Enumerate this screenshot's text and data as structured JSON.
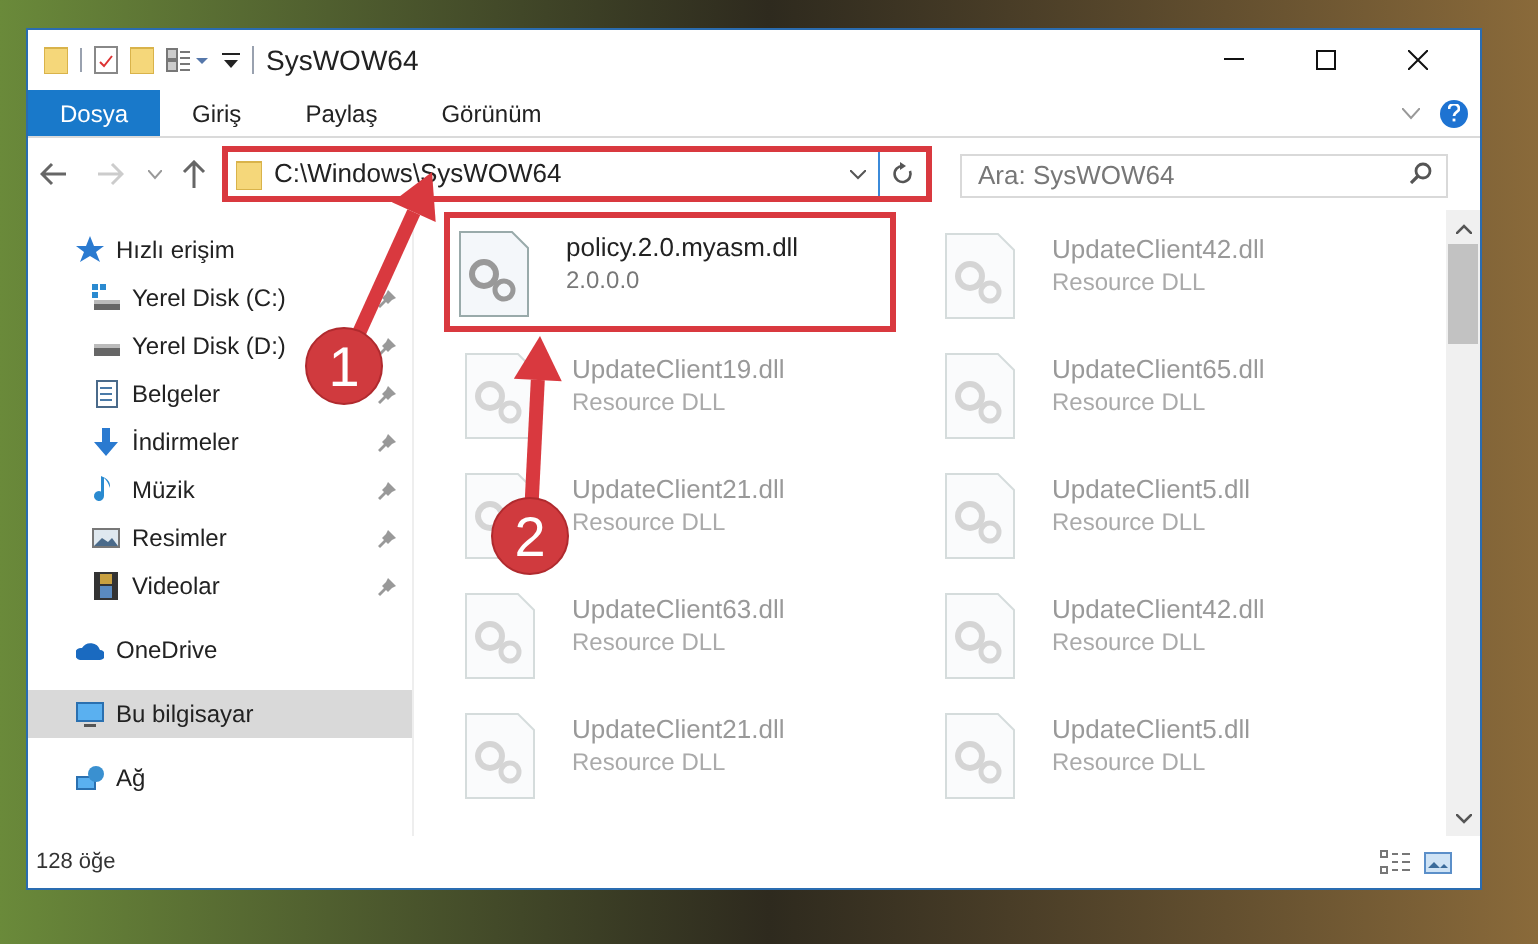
{
  "window": {
    "title": "SysWOW64"
  },
  "ribbon_tabs": [
    {
      "label": "Dosya",
      "selected": true
    },
    {
      "label": "Giriş",
      "selected": false
    },
    {
      "label": "Paylaş",
      "selected": false
    },
    {
      "label": "Görünüm",
      "selected": false
    }
  ],
  "address_bar": {
    "path": "C:\\Windows\\SysWOW64",
    "highlighted": true
  },
  "search": {
    "placeholder": "Ara: SysWOW64"
  },
  "sidebar": {
    "items": [
      {
        "label": "Hızlı erişim",
        "selected": false,
        "children": [
          {
            "label": "Yerel Disk (C:)",
            "pinned": true
          },
          {
            "label": "Yerel Disk (D:)",
            "pinned": true
          },
          {
            "label": "Belgeler",
            "pinned": true
          },
          {
            "label": "İndirmeler",
            "pinned": true
          },
          {
            "label": "Müzik",
            "pinned": true
          },
          {
            "label": "Resimler",
            "pinned": true
          },
          {
            "label": "Videolar",
            "pinned": true
          }
        ]
      },
      {
        "label": "OneDrive",
        "selected": false
      },
      {
        "label": "Bu bilgisayar",
        "selected": true
      },
      {
        "label": "Ağ",
        "selected": false
      }
    ]
  },
  "files": [
    {
      "name": "policy.2.0.myasm.dll",
      "detail": "2.0.0.0",
      "dimmed": false,
      "highlighted": true
    },
    {
      "name": "UpdateClient42.dll",
      "detail": "Resource DLL",
      "dimmed": true,
      "highlighted": false
    },
    {
      "name": "UpdateClient19.dll",
      "detail": "Resource DLL",
      "dimmed": true,
      "highlighted": false
    },
    {
      "name": "UpdateClient65.dll",
      "detail": "Resource DLL",
      "dimmed": true,
      "highlighted": false
    },
    {
      "name": "UpdateClient21.dll",
      "detail": "Resource DLL",
      "dimmed": true,
      "highlighted": false
    },
    {
      "name": "UpdateClient5.dll",
      "detail": "Resource DLL",
      "dimmed": true,
      "highlighted": false
    },
    {
      "name": "UpdateClient63.dll",
      "detail": "Resource DLL",
      "dimmed": true,
      "highlighted": false
    },
    {
      "name": "UpdateClient42.dll",
      "detail": "Resource DLL",
      "dimmed": true,
      "highlighted": false
    },
    {
      "name": "UpdateClient21.dll",
      "detail": "Resource DLL",
      "dimmed": true,
      "highlighted": false
    },
    {
      "name": "UpdateClient5.dll",
      "detail": "Resource DLL",
      "dimmed": true,
      "highlighted": false
    }
  ],
  "status_bar": {
    "item_count": "128 öğe"
  },
  "callouts": [
    {
      "label": "1"
    },
    {
      "label": "2"
    }
  ]
}
